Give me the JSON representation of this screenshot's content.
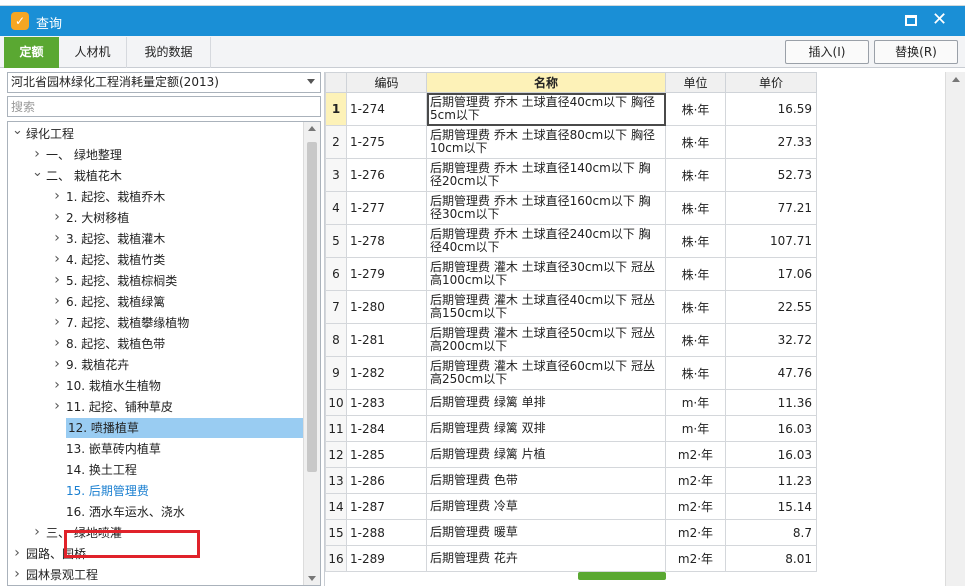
{
  "window": {
    "title": "查询"
  },
  "tabs": [
    {
      "label": "定额",
      "active": true
    },
    {
      "label": "人材机",
      "active": false
    },
    {
      "label": "我的数据",
      "active": false
    }
  ],
  "buttons": {
    "insert": "插入(I)",
    "replace": "替换(R)"
  },
  "left": {
    "dropdown_value": "河北省园林绿化工程消耗量定额(2013)",
    "search_placeholder": "搜索",
    "tree": [
      {
        "label": "绿化工程",
        "level": 0,
        "expander": "down"
      },
      {
        "label": "一、 绿地整理",
        "level": 1,
        "expander": "right"
      },
      {
        "label": "二、 栽植花木",
        "level": 1,
        "expander": "down"
      },
      {
        "label": "1. 起挖、栽植乔木",
        "level": 2,
        "expander": "right"
      },
      {
        "label": "2. 大树移植",
        "level": 2,
        "expander": "right"
      },
      {
        "label": "3. 起挖、栽植灌木",
        "level": 2,
        "expander": "right"
      },
      {
        "label": "4. 起挖、栽植竹类",
        "level": 2,
        "expander": "right"
      },
      {
        "label": "5. 起挖、栽植棕榈类",
        "level": 2,
        "expander": "right"
      },
      {
        "label": "6. 起挖、栽植绿篱",
        "level": 2,
        "expander": "right"
      },
      {
        "label": "7. 起挖、栽植攀缘植物",
        "level": 2,
        "expander": "right"
      },
      {
        "label": "8. 起挖、栽植色带",
        "level": 2,
        "expander": "right"
      },
      {
        "label": "9. 栽植花卉",
        "level": 2,
        "expander": "right"
      },
      {
        "label": "10. 栽植水生植物",
        "level": 2,
        "expander": "right"
      },
      {
        "label": "11. 起挖、铺种草皮",
        "level": 2,
        "expander": "right"
      },
      {
        "label": "12. 喷播植草",
        "level": 2,
        "expander": "none",
        "selected": true
      },
      {
        "label": "13. 嵌草砖内植草",
        "level": 2,
        "expander": "none"
      },
      {
        "label": "14. 换土工程",
        "level": 2,
        "expander": "none"
      },
      {
        "label": "15. 后期管理费",
        "level": 2,
        "expander": "none",
        "highlight": true
      },
      {
        "label": "16. 洒水车运水、浇水",
        "level": 2,
        "expander": "none"
      },
      {
        "label": "三、 绿地喷灌",
        "level": 1,
        "expander": "right"
      },
      {
        "label": "园路、园桥",
        "level": 0,
        "expander": "right"
      },
      {
        "label": "园林景观工程",
        "level": 0,
        "expander": "right"
      }
    ]
  },
  "grid": {
    "headers": {
      "code": "编码",
      "name": "名称",
      "unit": "单位",
      "price": "单价"
    },
    "rows": [
      {
        "idx": "1",
        "code": "1-274",
        "name": "后期管理费 乔木 土球直径40cm以下 胸径5cm以下",
        "unit": "株·年",
        "price": "16.59"
      },
      {
        "idx": "2",
        "code": "1-275",
        "name": "后期管理费 乔木 土球直径80cm以下 胸径10cm以下",
        "unit": "株·年",
        "price": "27.33"
      },
      {
        "idx": "3",
        "code": "1-276",
        "name": "后期管理费 乔木 土球直径140cm以下 胸径20cm以下",
        "unit": "株·年",
        "price": "52.73"
      },
      {
        "idx": "4",
        "code": "1-277",
        "name": "后期管理费 乔木 土球直径160cm以下 胸径30cm以下",
        "unit": "株·年",
        "price": "77.21"
      },
      {
        "idx": "5",
        "code": "1-278",
        "name": "后期管理费 乔木 土球直径240cm以下 胸径40cm以下",
        "unit": "株·年",
        "price": "107.71"
      },
      {
        "idx": "6",
        "code": "1-279",
        "name": "后期管理费 灌木 土球直径30cm以下 冠丛高100cm以下",
        "unit": "株·年",
        "price": "17.06"
      },
      {
        "idx": "7",
        "code": "1-280",
        "name": "后期管理费 灌木 土球直径40cm以下 冠丛高150cm以下",
        "unit": "株·年",
        "price": "22.55"
      },
      {
        "idx": "8",
        "code": "1-281",
        "name": "后期管理费 灌木 土球直径50cm以下 冠丛高200cm以下",
        "unit": "株·年",
        "price": "32.72"
      },
      {
        "idx": "9",
        "code": "1-282",
        "name": "后期管理费 灌木 土球直径60cm以下 冠丛高250cm以下",
        "unit": "株·年",
        "price": "47.76"
      },
      {
        "idx": "10",
        "code": "1-283",
        "name": "后期管理费 绿篱 单排",
        "unit": "m·年",
        "price": "11.36"
      },
      {
        "idx": "11",
        "code": "1-284",
        "name": "后期管理费 绿篱 双排",
        "unit": "m·年",
        "price": "16.03"
      },
      {
        "idx": "12",
        "code": "1-285",
        "name": "后期管理费 绿篱 片植",
        "unit": "m2·年",
        "price": "16.03"
      },
      {
        "idx": "13",
        "code": "1-286",
        "name": "后期管理费 色带",
        "unit": "m2·年",
        "price": "11.23"
      },
      {
        "idx": "14",
        "code": "1-287",
        "name": "后期管理费 冷草",
        "unit": "m2·年",
        "price": "15.14"
      },
      {
        "idx": "15",
        "code": "1-288",
        "name": "后期管理费 暖草",
        "unit": "m2·年",
        "price": "8.7"
      },
      {
        "idx": "16",
        "code": "1-289",
        "name": "后期管理费 花卉",
        "unit": "m2·年",
        "price": "8.01"
      }
    ]
  },
  "colors": {
    "titlebar": "#1a8fd6",
    "active_tab": "#5aa832",
    "selected_tree": "#99ccf2",
    "highlight_box": "#e0222a",
    "name_header": "#fdf2b8"
  }
}
